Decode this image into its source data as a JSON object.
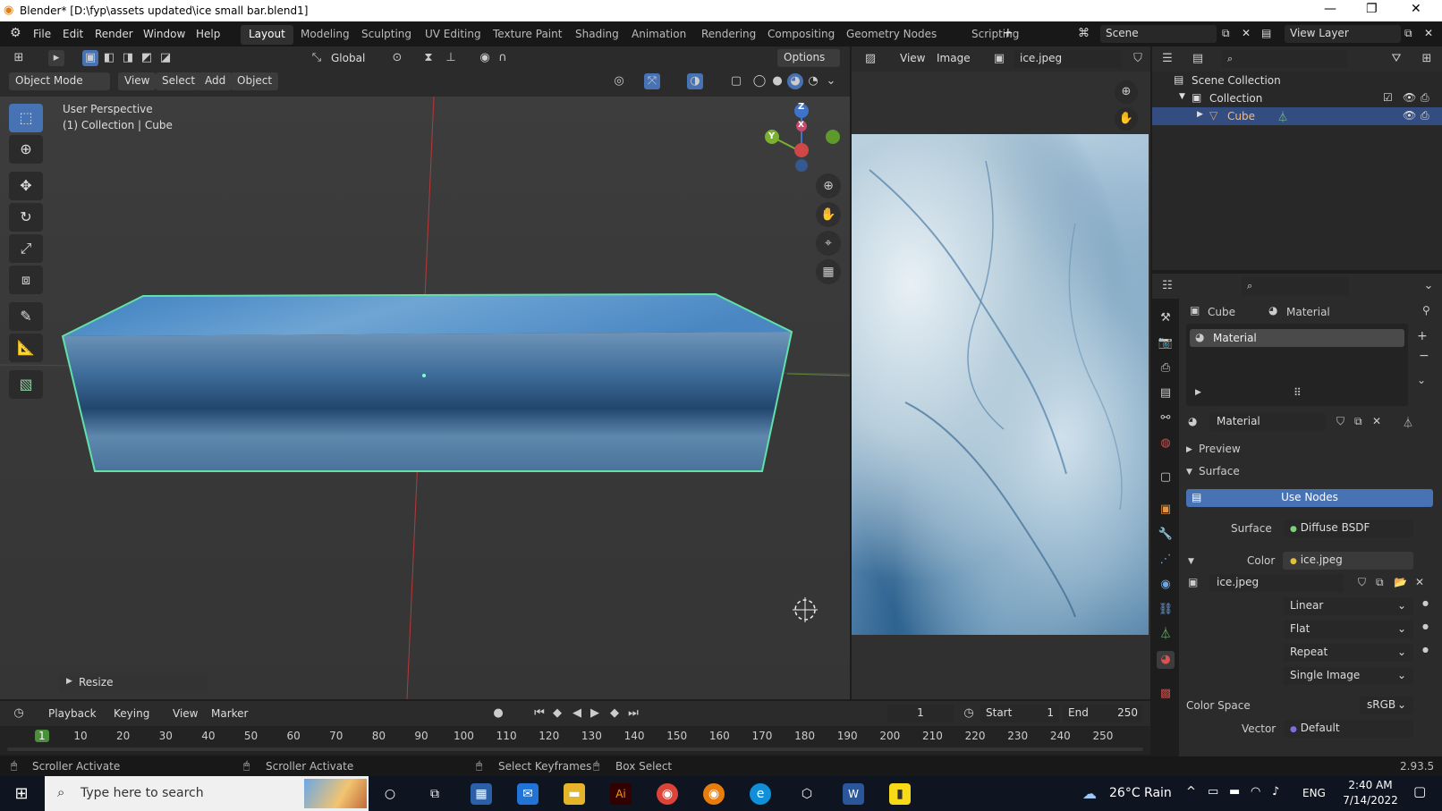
{
  "window": {
    "title": "Blender* [D:\\fyp\\assets updated\\ice small bar.blend1]",
    "minimize": "—",
    "maximize": "❐",
    "close": "✕"
  },
  "menu": [
    "File",
    "Edit",
    "Render",
    "Window",
    "Help"
  ],
  "workspaces": [
    "Layout",
    "Modeling",
    "Sculpting",
    "UV Editing",
    "Texture Paint",
    "Shading",
    "Animation",
    "Rendering",
    "Compositing",
    "Geometry Nodes",
    "Scripting"
  ],
  "scene": {
    "name": "Scene",
    "view_layer": "View Layer"
  },
  "viewport": {
    "transform": "Global",
    "options": "Options",
    "mode": "Object Mode",
    "menus": [
      "View",
      "Select",
      "Add",
      "Object"
    ],
    "info_line1": "User Perspective",
    "info_line2": "(1) Collection | Cube",
    "gizmo": {
      "z": "Z",
      "y": "Y",
      "x": "X"
    },
    "operator_panel": "Resize"
  },
  "image_editor": {
    "menus": [
      "View",
      "Image"
    ],
    "image_name": "ice.jpeg"
  },
  "outliner": {
    "scene_collection": "Scene Collection",
    "collection": "Collection",
    "object": "Cube"
  },
  "properties": {
    "breadcrumb_object": "Cube",
    "breadcrumb_material": "Material",
    "slot": "Material",
    "material_name": "Material",
    "preview": "Preview",
    "surface_section": "Surface",
    "use_nodes": "Use Nodes",
    "surface_label": "Surface",
    "surface_value": "Diffuse BSDF",
    "color_label": "Color",
    "color_value": "ice.jpeg",
    "image_name": "ice.jpeg",
    "interpolation": "Linear",
    "projection": "Flat",
    "extension": "Repeat",
    "source": "Single Image",
    "color_space_label": "Color Space",
    "color_space": "sRGB",
    "vector_label": "Vector",
    "vector_value": "Default"
  },
  "timeline": {
    "menus": [
      "Playback",
      "Keying",
      "View",
      "Marker"
    ],
    "current_frame": "1",
    "start_label": "Start",
    "start": "1",
    "end_label": "End",
    "end": "250",
    "ticks": [
      "1",
      "10",
      "20",
      "30",
      "40",
      "50",
      "60",
      "70",
      "80",
      "90",
      "100",
      "110",
      "120",
      "130",
      "140",
      "150",
      "160",
      "170",
      "180",
      "190",
      "200",
      "210",
      "220",
      "230",
      "240",
      "250"
    ]
  },
  "statusbar": {
    "item1": "Scroller Activate",
    "item2": "Scroller Activate",
    "item3": "Select Keyframes",
    "item4": "Box Select",
    "version": "2.93.5"
  },
  "taskbar": {
    "search_placeholder": "Type here to search",
    "weather": "26°C Rain",
    "lang": "ENG",
    "time": "2:40 AM",
    "date": "7/14/2022"
  }
}
